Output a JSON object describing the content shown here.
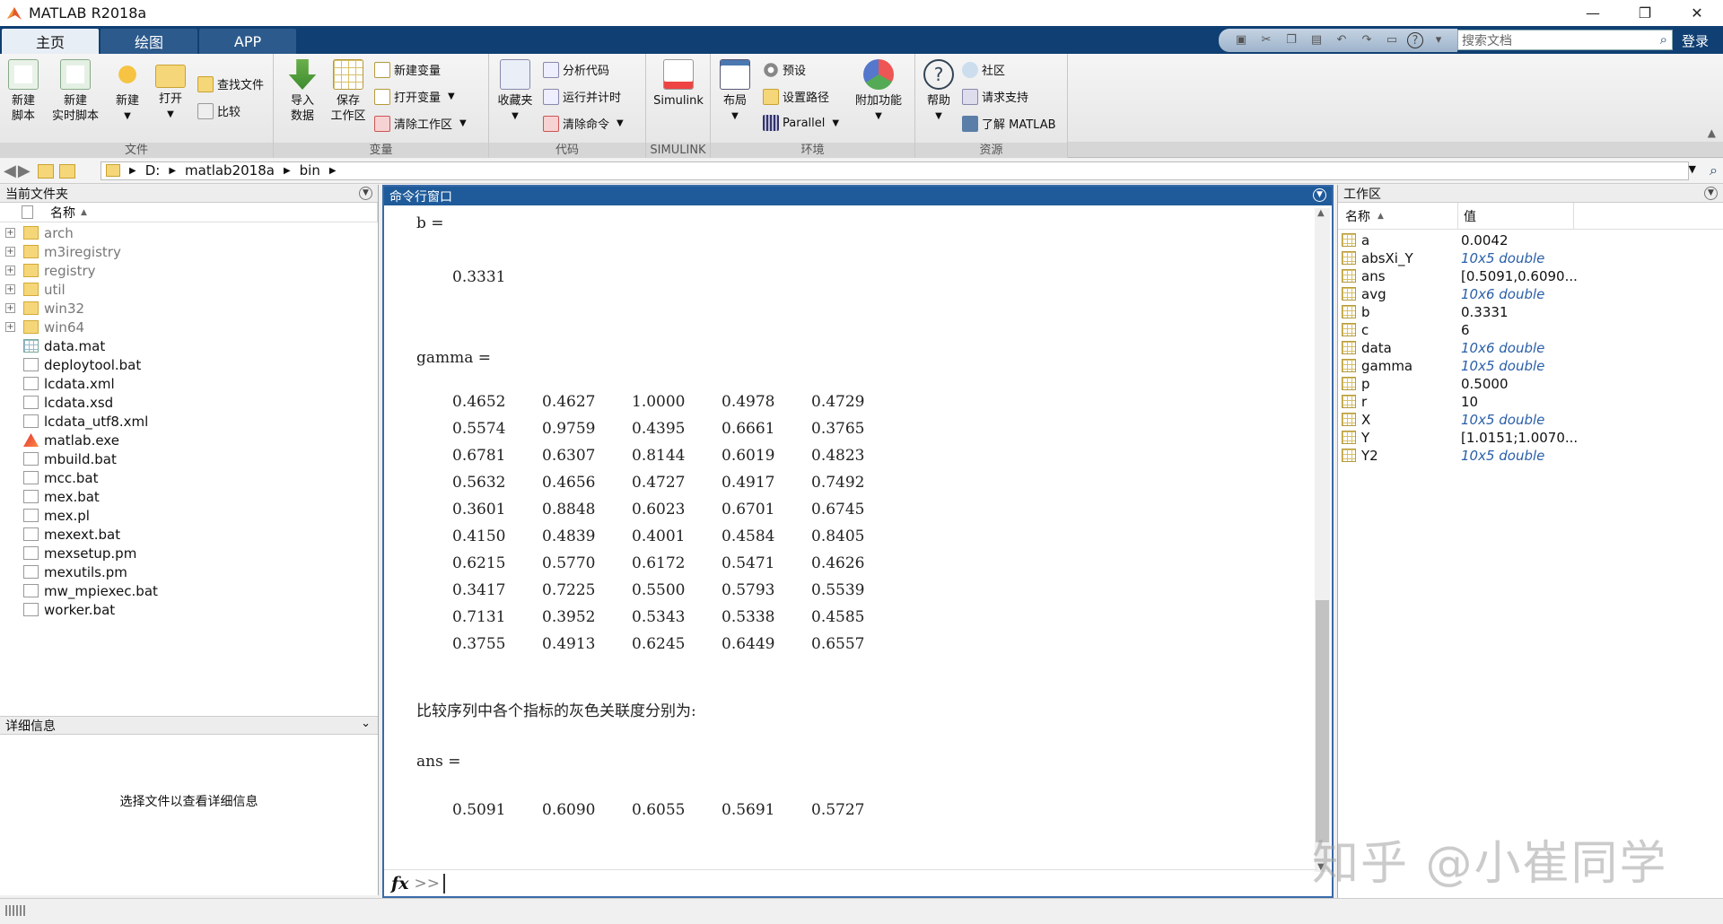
{
  "window": {
    "title": "MATLAB R2018a"
  },
  "tabs": [
    "主页",
    "绘图",
    "APP"
  ],
  "search": {
    "placeholder": "搜索文档"
  },
  "login_label": "登录",
  "ribbon": {
    "groups": {
      "file": "文件",
      "variable": "变量",
      "code": "代码",
      "simulink": "SIMULINK",
      "env": "环境",
      "resources": "资源"
    },
    "new_script": "新建\n脚本",
    "new_live_script": "新建\n实时脚本",
    "new": "新建",
    "open": "打开",
    "find_files": "查找文件",
    "compare": "比较",
    "import_data": "导入\n数据",
    "save_workspace": "保存\n工作区",
    "new_variable": "新建变量",
    "open_variable": "打开变量",
    "clear_workspace": "清除工作区",
    "favorites": "收藏夹",
    "analyze_code": "分析代码",
    "run_and_time": "运行并计时",
    "clear_commands": "清除命令",
    "simulink": "Simulink",
    "layout": "布局",
    "preferences": "预设",
    "set_path": "设置路径",
    "parallel": "Parallel",
    "addons": "附加功能",
    "help": "帮助",
    "community": "社区",
    "request_support": "请求支持",
    "learn_matlab": "了解 MATLAB"
  },
  "address": {
    "parts": [
      "D:",
      "matlab2018a",
      "bin"
    ]
  },
  "current_folder": {
    "title": "当前文件夹",
    "col_name": "名称",
    "items": [
      {
        "name": "arch",
        "type": "folder"
      },
      {
        "name": "m3iregistry",
        "type": "folder"
      },
      {
        "name": "registry",
        "type": "folder"
      },
      {
        "name": "util",
        "type": "folder"
      },
      {
        "name": "win32",
        "type": "folder"
      },
      {
        "name": "win64",
        "type": "folder"
      },
      {
        "name": "data.mat",
        "type": "mat"
      },
      {
        "name": "deploytool.bat",
        "type": "file"
      },
      {
        "name": "lcdata.xml",
        "type": "file"
      },
      {
        "name": "lcdata.xsd",
        "type": "file"
      },
      {
        "name": "lcdata_utf8.xml",
        "type": "file"
      },
      {
        "name": "matlab.exe",
        "type": "exe"
      },
      {
        "name": "mbuild.bat",
        "type": "file"
      },
      {
        "name": "mcc.bat",
        "type": "file"
      },
      {
        "name": "mex.bat",
        "type": "file"
      },
      {
        "name": "mex.pl",
        "type": "file"
      },
      {
        "name": "mexext.bat",
        "type": "file"
      },
      {
        "name": "mexsetup.pm",
        "type": "file"
      },
      {
        "name": "mexutils.pm",
        "type": "file"
      },
      {
        "name": "mw_mpiexec.bat",
        "type": "file"
      },
      {
        "name": "worker.bat",
        "type": "file"
      }
    ]
  },
  "details": {
    "title": "详细信息",
    "message": "选择文件以查看详细信息"
  },
  "command_window": {
    "title": "命令行窗口",
    "b_label": "b =",
    "b_value": "0.3331",
    "gamma_label": "gamma =",
    "gamma_rows": [
      [
        "0.4652",
        "0.4627",
        "1.0000",
        "0.4978",
        "0.4729"
      ],
      [
        "0.5574",
        "0.9759",
        "0.4395",
        "0.6661",
        "0.3765"
      ],
      [
        "0.6781",
        "0.6307",
        "0.8144",
        "0.6019",
        "0.4823"
      ],
      [
        "0.5632",
        "0.4656",
        "0.4727",
        "0.4917",
        "0.7492"
      ],
      [
        "0.3601",
        "0.8848",
        "0.6023",
        "0.6701",
        "0.6745"
      ],
      [
        "0.4150",
        "0.4839",
        "0.4001",
        "0.4584",
        "0.8405"
      ],
      [
        "0.6215",
        "0.5770",
        "0.6172",
        "0.5471",
        "0.4626"
      ],
      [
        "0.3417",
        "0.7225",
        "0.5500",
        "0.5793",
        "0.5539"
      ],
      [
        "0.7131",
        "0.3952",
        "0.5343",
        "0.5338",
        "0.4585"
      ],
      [
        "0.3755",
        "0.4913",
        "0.6245",
        "0.6449",
        "0.6557"
      ]
    ],
    "message": "比较序列中各个指标的灰色关联度分别为:",
    "ans_label": "ans =",
    "ans_values": [
      "0.5091",
      "0.6090",
      "0.6055",
      "0.5691",
      "0.5727"
    ],
    "fx": "fx",
    "prompt": ">>"
  },
  "workspace": {
    "title": "工作区",
    "col_name": "名称",
    "col_value": "值",
    "vars": [
      {
        "name": "a",
        "value": "0.0042",
        "italic": false
      },
      {
        "name": "absXi_Y",
        "value": "10x5 double",
        "italic": true
      },
      {
        "name": "ans",
        "value": "[0.5091,0.6090...",
        "italic": false
      },
      {
        "name": "avg",
        "value": "10x6 double",
        "italic": true
      },
      {
        "name": "b",
        "value": "0.3331",
        "italic": false
      },
      {
        "name": "c",
        "value": "6",
        "italic": false
      },
      {
        "name": "data",
        "value": "10x6 double",
        "italic": true
      },
      {
        "name": "gamma",
        "value": "10x5 double",
        "italic": true
      },
      {
        "name": "p",
        "value": "0.5000",
        "italic": false
      },
      {
        "name": "r",
        "value": "10",
        "italic": false
      },
      {
        "name": "X",
        "value": "10x5 double",
        "italic": true
      },
      {
        "name": "Y",
        "value": "[1.0151;1.0070...",
        "italic": false
      },
      {
        "name": "Y2",
        "value": "10x5 double",
        "italic": true
      }
    ]
  },
  "watermark": "知乎 @小崔同学"
}
